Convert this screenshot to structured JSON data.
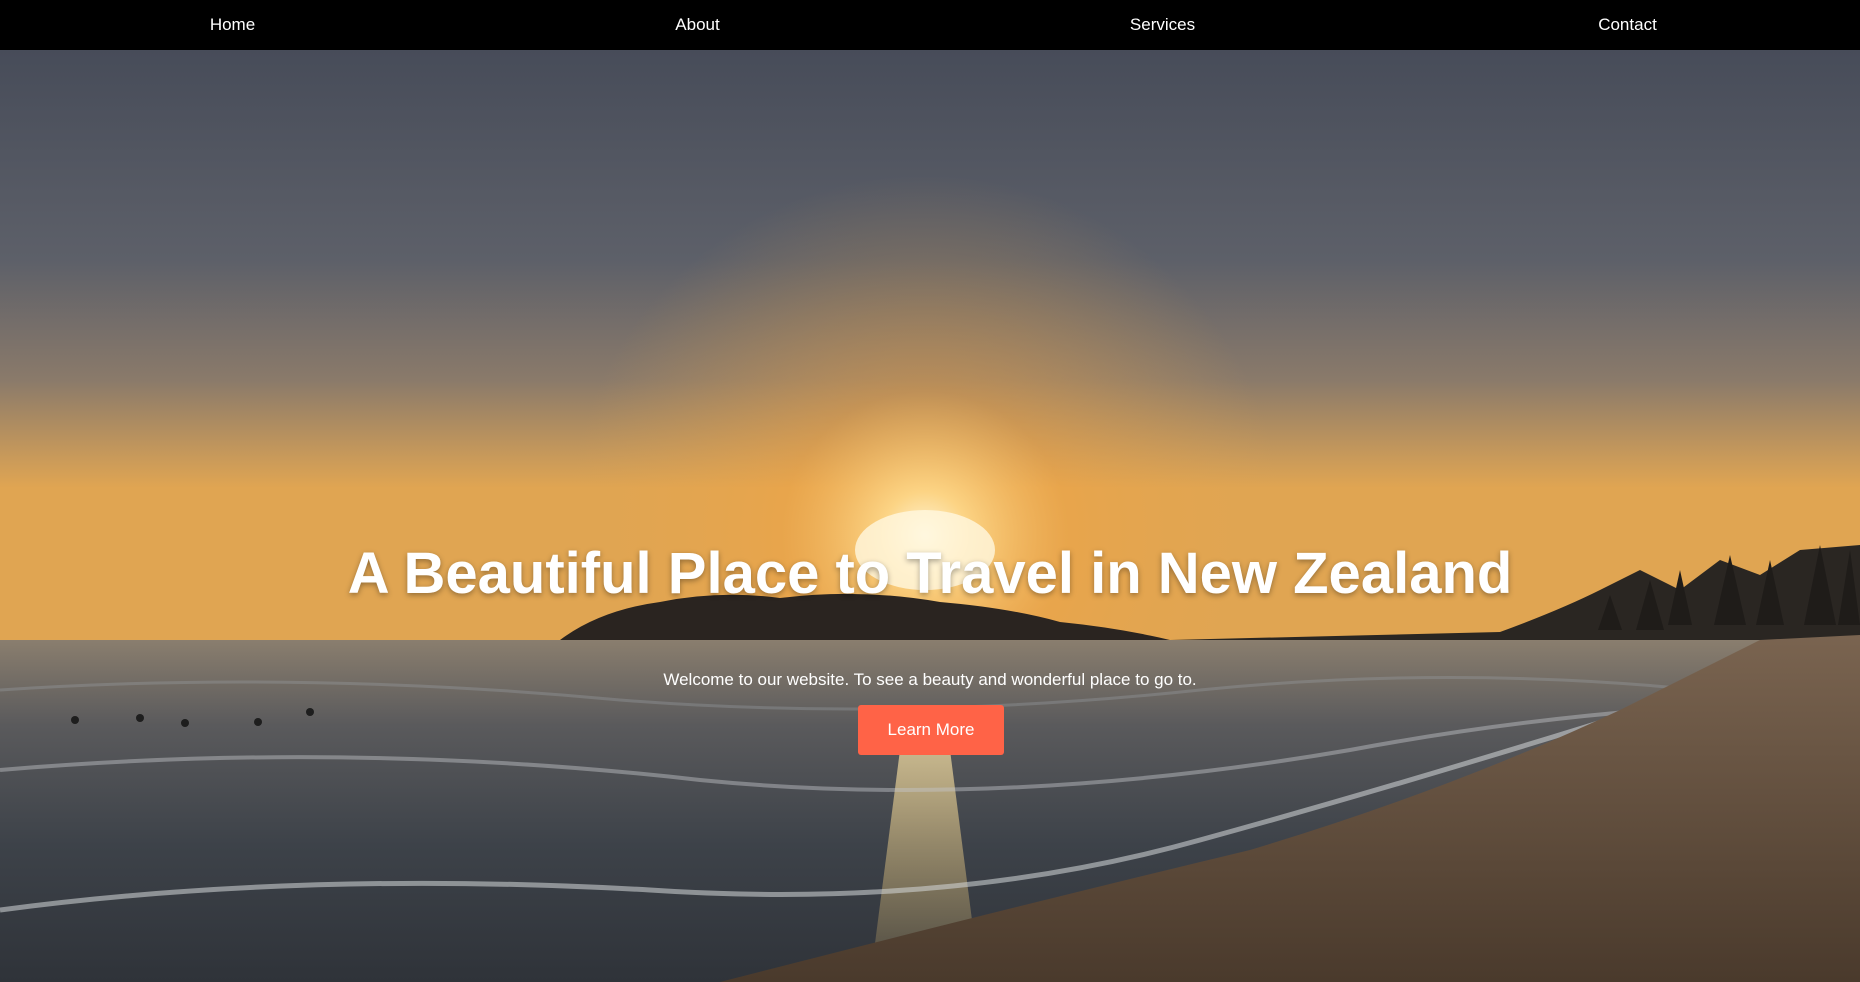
{
  "nav": {
    "items": [
      {
        "label": "Home"
      },
      {
        "label": "About"
      },
      {
        "label": "Services"
      },
      {
        "label": "Contact"
      }
    ]
  },
  "hero": {
    "title": "A Beautiful Place to Travel in New Zealand",
    "subtitle": "Welcome to our website. To see a beauty and wonderful place to go to.",
    "button_label": "Learn More",
    "background_image": "beach-sunset-photo"
  },
  "colors": {
    "navbar_bg": "#000000",
    "button_bg": "#ff6347",
    "text": "#ffffff"
  }
}
